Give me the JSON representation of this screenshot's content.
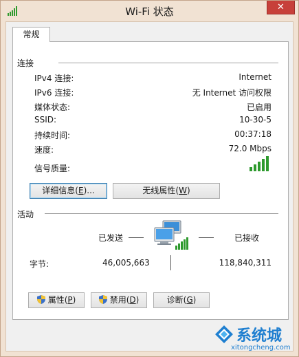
{
  "window": {
    "title": "Wi-Fi 状态",
    "close_label": "✕"
  },
  "tab": {
    "label": "常规"
  },
  "connection": {
    "heading": "连接",
    "rows": [
      {
        "label": "IPv4 连接:",
        "value": "Internet"
      },
      {
        "label": "IPv6 连接:",
        "value": "无 Internet 访问权限"
      },
      {
        "label": "媒体状态:",
        "value": "已启用"
      },
      {
        "label": "SSID:",
        "value": "10-30-5"
      },
      {
        "label": "持续时间:",
        "value": "00:37:18"
      },
      {
        "label": "速度:",
        "value": "72.0 Mbps"
      }
    ],
    "signal_label": "信号质量:",
    "signal_bars": 5,
    "details_button": {
      "text": "详细信息(",
      "key": "E",
      "suffix": ")..."
    },
    "wireless_button": {
      "text": "无线属性(",
      "key": "W",
      "suffix": ")"
    }
  },
  "activity": {
    "heading": "活动",
    "sent_label": "已发送",
    "received_label": "已接收",
    "bytes_label": "字节:",
    "bytes_sent": "46,005,663",
    "bytes_received": "118,840,311"
  },
  "buttons": {
    "properties": {
      "text": "属性(",
      "key": "P",
      "suffix": ")"
    },
    "disable": {
      "text": "禁用(",
      "key": "D",
      "suffix": ")"
    },
    "diagnose": {
      "text": "诊断(",
      "key": "G",
      "suffix": ")"
    }
  },
  "watermark": {
    "text": "系统城",
    "url": "xitongcheng.com"
  },
  "colors": {
    "signal_green": "#2e9a2e",
    "frame": "#f1e2d3",
    "close_red": "#c7403a",
    "watermark_blue": "#1f7fd0"
  }
}
